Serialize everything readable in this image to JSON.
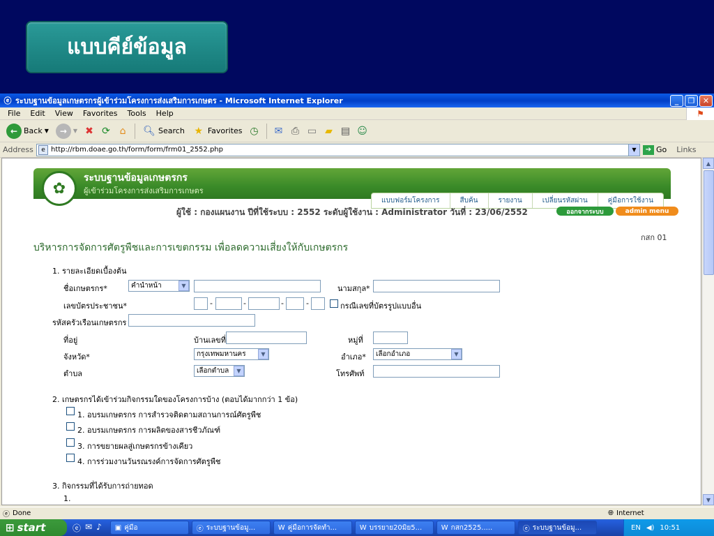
{
  "slide": {
    "badge_text": "แบบคีย์ข้อมูล"
  },
  "window": {
    "title": "ระบบฐานข้อมูลเกษตรกรผู้เข้าร่วมโครงการส่งเสริมการเกษตร - Microsoft Internet Explorer",
    "menu": [
      "File",
      "Edit",
      "View",
      "Favorites",
      "Tools",
      "Help"
    ],
    "toolbar": {
      "back": "Back",
      "search": "Search",
      "favorites": "Favorites"
    },
    "address_label": "Address",
    "url": "http://rbm.doae.go.th/form/form/frm01_2552.php",
    "go": "Go",
    "links": "Links"
  },
  "page": {
    "header_title": "ระบบฐานข้อมูลเกษตรกร",
    "header_subtitle": "ผู้เข้าร่วมโครงการส่งเสริมการเกษตร",
    "nav_tabs": [
      "แบบฟอร์มโครงการ",
      "สืบค้น",
      "รายงาน",
      "เปลี่ยนรหัสผ่าน",
      "คู่มือการใช้งาน"
    ],
    "user_line": "ผู้ใช้ : กองแผนงาน   ปีที่ใช้ระบบ : 2552   ระดับผู้ใช้งาน : Administrator   วันที่ : 23/06/2552",
    "logout": "ออกจากระบบ",
    "admin_menu": "admin menu",
    "form_code": "กสก 01",
    "form_title": "บริหารการจัดการศัตรูพืชและการเขตกรรม เพื่อลดความเสี่ยงให้กับเกษตรกร",
    "section1": "1. รายละเอียดเบื้องต้น",
    "farmer_name_label": "ชื่อเกษตรกร*",
    "title_select": "คำนำหน้า",
    "surname_label": "นามสกุล*",
    "id_label": "เลขบัตรประชาชน*",
    "other_id": "กรณีเลขที่บัตรรูปแบบอื่น",
    "household_label": "รหัสครัวเรือนเกษตรกร",
    "address_label": "ที่อยู่",
    "house_no_label": "บ้านเลขที่",
    "moo_label": "หมู่ที่",
    "province_label": "จังหวัด*",
    "province_select": "กรุงเทพมหานคร",
    "district_label": "อำเภอ*",
    "district_select": "เลือกอำเภอ",
    "subdistrict_label": "ตำบล",
    "subdistrict_select": "เลือกตำบล",
    "phone_label": "โทรศัพท์",
    "section2": "2. เกษตรกรได้เข้าร่วมกิจกรรมใดของโครงการบ้าง (ตอบได้มากกว่า 1 ข้อ)",
    "activities": [
      "1. อบรมเกษตรกร การสำรวจติดตามสถานการณ์ศัตรูพืช",
      "2. อบรมเกษตรกร การผลิตของสารชีวภัณฑ์",
      "3. การขยายผลสู่เกษตรกรข้างเคียว",
      "4. การร่วมงานวันรณรงค์การจัดการศัตรูพืช"
    ],
    "section3": "3. กิจกรรมที่ได้รับการถ่ายทอด",
    "section3_item": "1."
  },
  "status": {
    "text": "Done",
    "zone": "Internet"
  },
  "taskbar": {
    "start": "start",
    "tasks": [
      "คู่มือ",
      "ระบบฐานข้อมู...",
      "คู่มือการจัดทำ...",
      "บรรยาย20มิย5...",
      "กสก2525.....",
      "ระบบฐานข้อมู..."
    ],
    "lang": "EN",
    "clock": "10:51"
  }
}
